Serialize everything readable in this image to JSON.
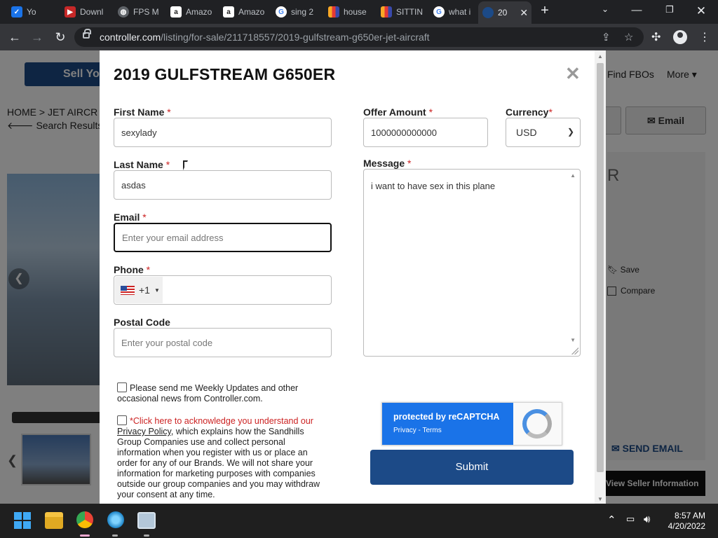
{
  "browser": {
    "tabs": [
      {
        "label": "Yo",
        "icon": "mail-check-icon",
        "color": "#1a73e8"
      },
      {
        "label": "Downl",
        "icon": "download-site-icon",
        "color": "#c62828"
      },
      {
        "label": "FPS M",
        "icon": "globe-icon",
        "color": "#5f6368"
      },
      {
        "label": "Amazo",
        "icon": "amazon-icon",
        "color": "#222222"
      },
      {
        "label": "Amazo",
        "icon": "amazon-icon",
        "color": "#222222"
      },
      {
        "label": "sing 2",
        "icon": "google-icon",
        "color": "#4285f4"
      },
      {
        "label": "house",
        "icon": "bar-icon",
        "color": "#f9a825"
      },
      {
        "label": "SITTIN",
        "icon": "bar-icon",
        "color": "#f9a825"
      },
      {
        "label": "what i",
        "icon": "google-icon",
        "color": "#4285f4"
      },
      {
        "label": "20",
        "icon": "controller-icon",
        "color": "#1c4a87",
        "active": true
      }
    ],
    "url_host": "controller.com",
    "url_path": "/listing/for-sale/211718557/2019-gulfstream-g650er-jet-aircraft"
  },
  "background": {
    "sell_button": "Sell Yo",
    "breadcrumb": "HOME > JET AIRCR",
    "back_link": "Search Results",
    "nav_find_fbos": "Find FBOs",
    "nav_more": "More ▾",
    "email_button": "Email",
    "title_fragment": "R",
    "save_label": "Save",
    "compare_label": "Compare",
    "send_email": "SEND EMAIL",
    "view_seller": "View Seller Information"
  },
  "modal": {
    "title": "2019 GULFSTREAM G650ER",
    "first_name": {
      "label": "First Name",
      "value": "sexylady"
    },
    "last_name": {
      "label": "Last Name",
      "value": "asdas"
    },
    "email": {
      "label": "Email",
      "value": "",
      "placeholder": "Enter your email address"
    },
    "phone": {
      "label": "Phone",
      "country_code": "+1"
    },
    "postal_code": {
      "label": "Postal Code",
      "value": "",
      "placeholder": "Enter your postal code"
    },
    "offer_amount": {
      "label": "Offer Amount",
      "value": "1000000000000"
    },
    "currency": {
      "label": "Currency",
      "value": "USD"
    },
    "message": {
      "label": "Message",
      "value": "i want to have sex in this plane"
    },
    "required_mark": "*",
    "weekly_updates": "Please send me Weekly Updates and other occasional news from Controller.com.",
    "privacy_prefix": "*Click here to acknowledge you understand our ",
    "privacy_link": "Privacy Policy",
    "privacy_suffix": ", which explains how the Sandhills Group Companies use and collect personal information when you register with us or place an order for any of our Brands. We will not share your information for marketing purposes with companies outside our group companies and you may withdraw your consent at any time.",
    "recaptcha_text": "protected by reCAPTCHA",
    "recaptcha_links": "Privacy - Terms",
    "submit": "Submit"
  },
  "taskbar": {
    "time": "8:57 AM",
    "date": "4/20/2022"
  }
}
